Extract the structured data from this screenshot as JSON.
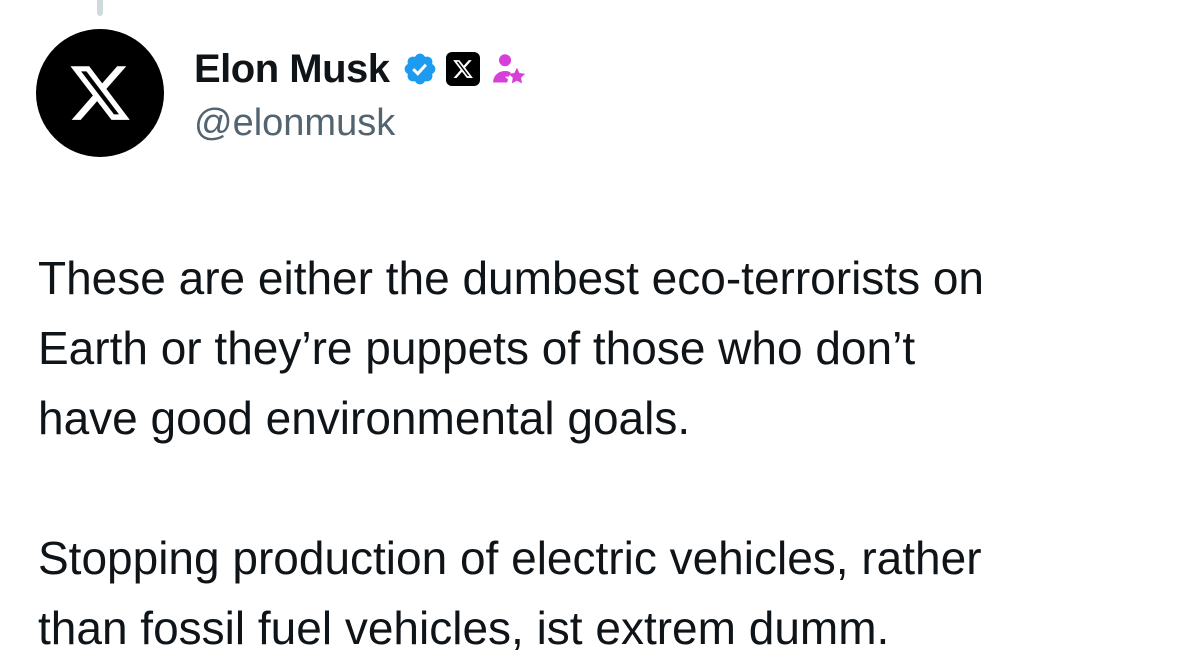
{
  "tweet": {
    "author": {
      "display_name": "Elon Musk",
      "handle": "@elonmusk",
      "avatar_icon": "x-logo-icon",
      "badges": [
        "verified-badge-icon",
        "x-affiliate-badge-icon",
        "government-official-badge-icon"
      ],
      "verified_color": "#1d9bf0",
      "gov_badge_color": "#d63fd8"
    },
    "text_lines": {
      "p1_l1": "These are either the dumbest eco-terrorists on",
      "p1_l2": "Earth or they’re puppets of those who don’t",
      "p1_l3": "have good environmental goals.",
      "p2_l1": "Stopping production of electric vehicles, rather",
      "p2_l2": "than fossil fuel vehicles, ist extrem dumm."
    }
  }
}
